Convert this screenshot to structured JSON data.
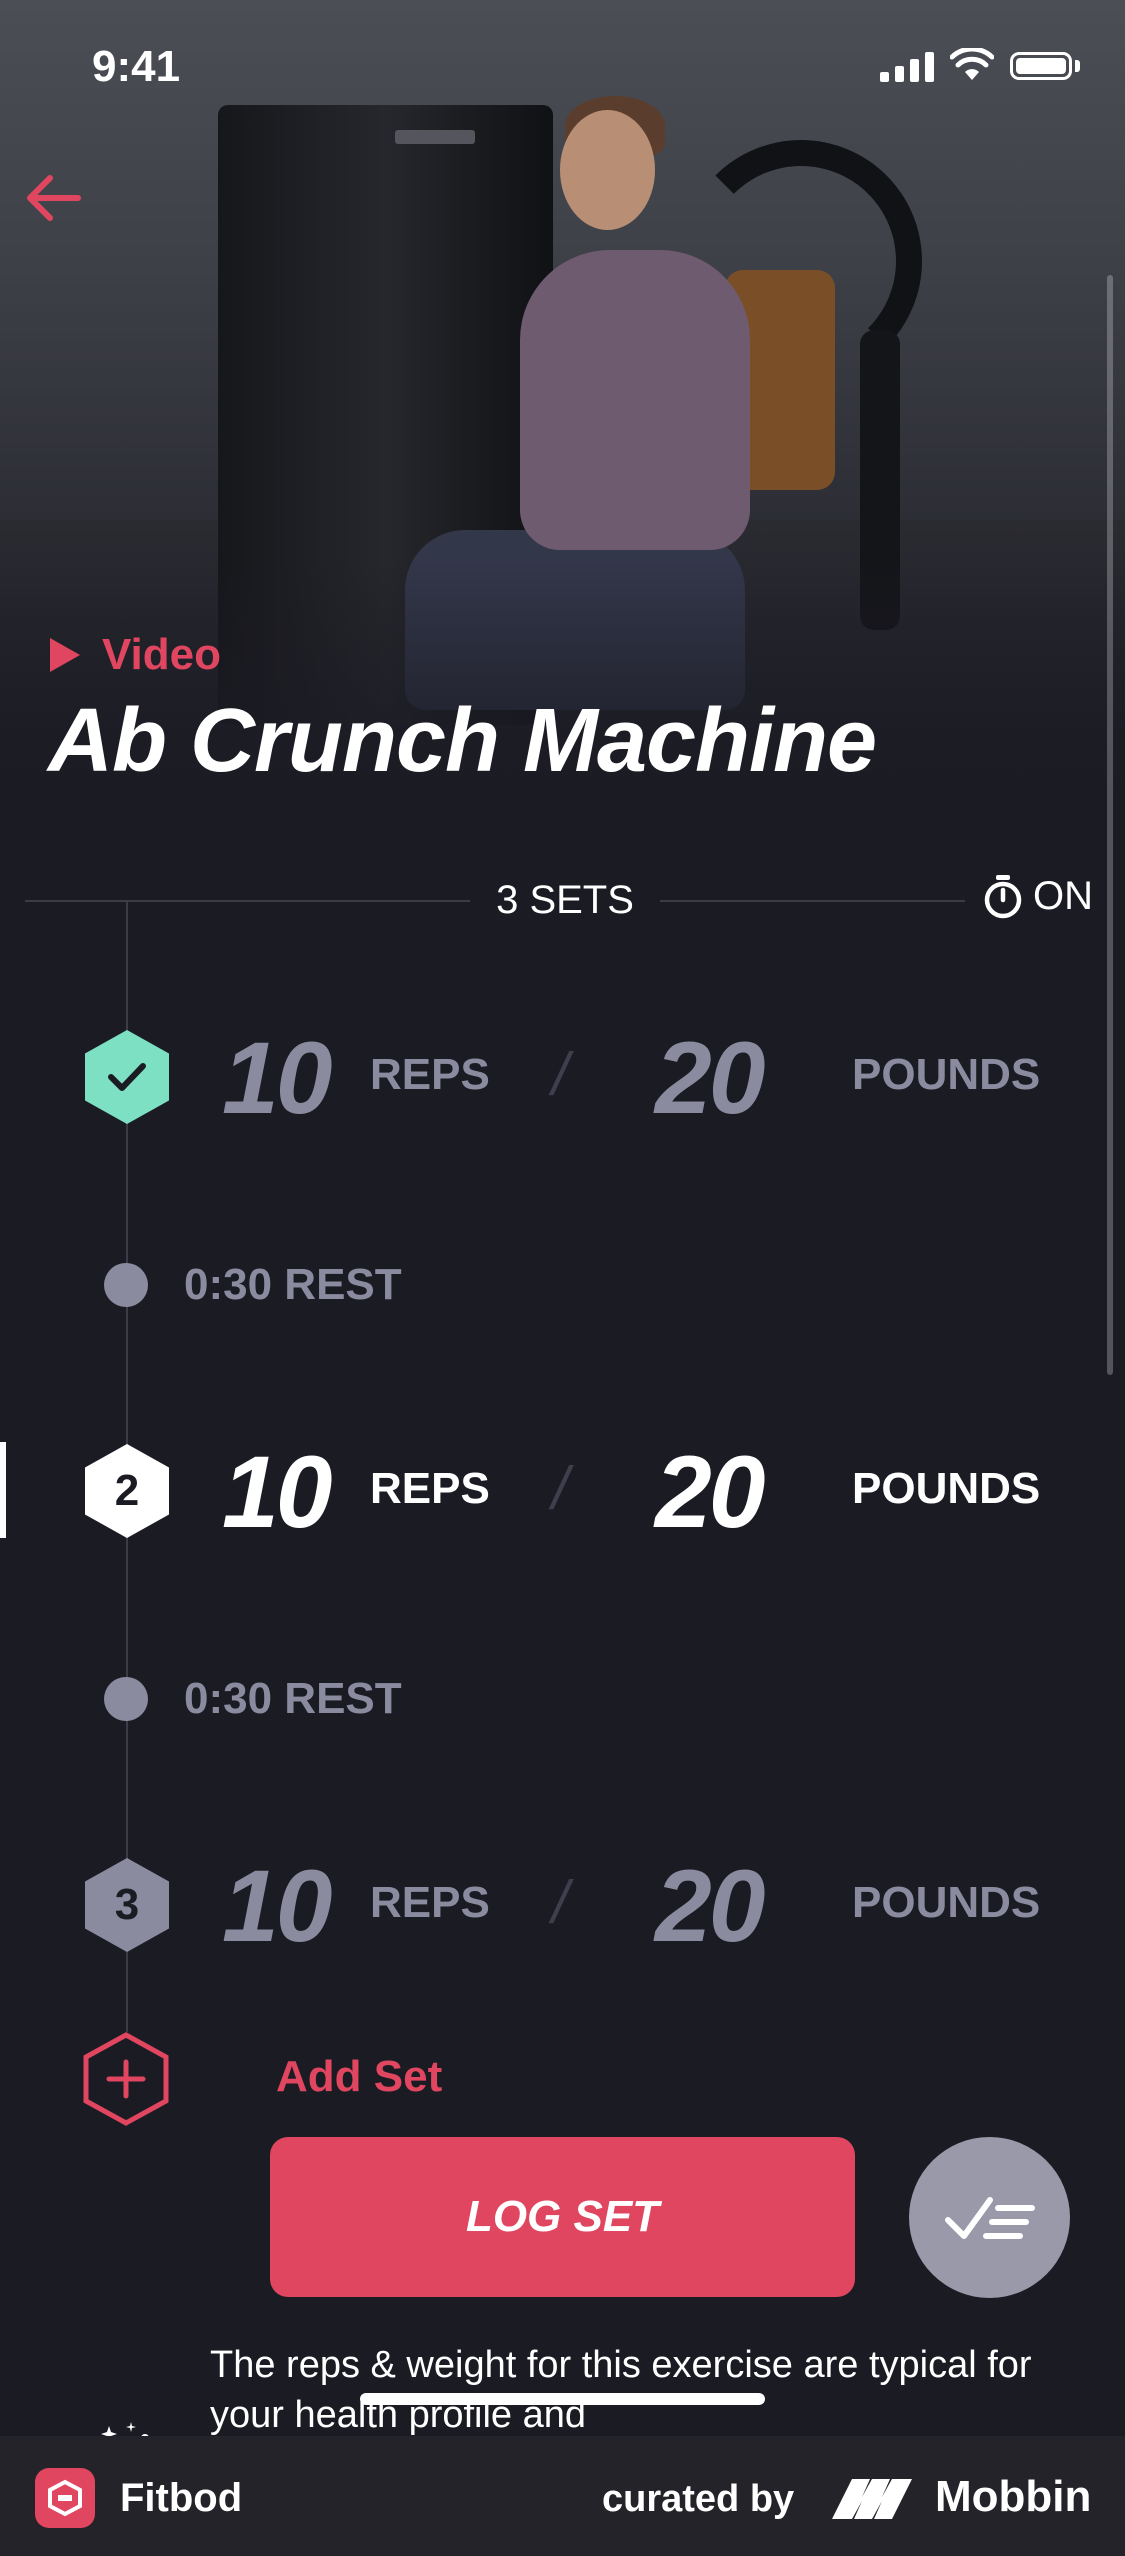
{
  "status_bar": {
    "time": "9:41"
  },
  "hero": {
    "video_label": "Video",
    "exercise_title": "Ab Crunch Machine"
  },
  "sets_header": {
    "sets_label": "3 SETS",
    "timer_state": "ON"
  },
  "sets": [
    {
      "badge": "",
      "status": "completed",
      "reps": "10",
      "reps_label": "REPS",
      "weight": "20",
      "weight_label": "POUNDS"
    },
    {
      "badge": "2",
      "status": "current",
      "reps": "10",
      "reps_label": "REPS",
      "weight": "20",
      "weight_label": "POUNDS"
    },
    {
      "badge": "3",
      "status": "upcoming",
      "reps": "10",
      "reps_label": "REPS",
      "weight": "20",
      "weight_label": "POUNDS"
    }
  ],
  "rests": [
    {
      "label": "0:30 REST"
    },
    {
      "label": "0:30 REST"
    }
  ],
  "add_set_label": "Add Set",
  "log_set_label": "LOG SET",
  "description": "The reps & weight for this exercise are typical for your health profile and",
  "footer": {
    "app_name": "Fitbod",
    "curated_by": "curated by",
    "brand": "Mobbin"
  },
  "colors": {
    "accent": "#e0465f",
    "done": "#7de0c3",
    "muted": "#8b8ba0",
    "background": "#1b1b24"
  },
  "icons": [
    "back-arrow-icon",
    "play-icon",
    "stopwatch-icon",
    "checkmark-icon",
    "plus-icon",
    "checklist-icon",
    "sparkle-icon",
    "wifi-icon",
    "signal-icon",
    "battery-icon"
  ]
}
